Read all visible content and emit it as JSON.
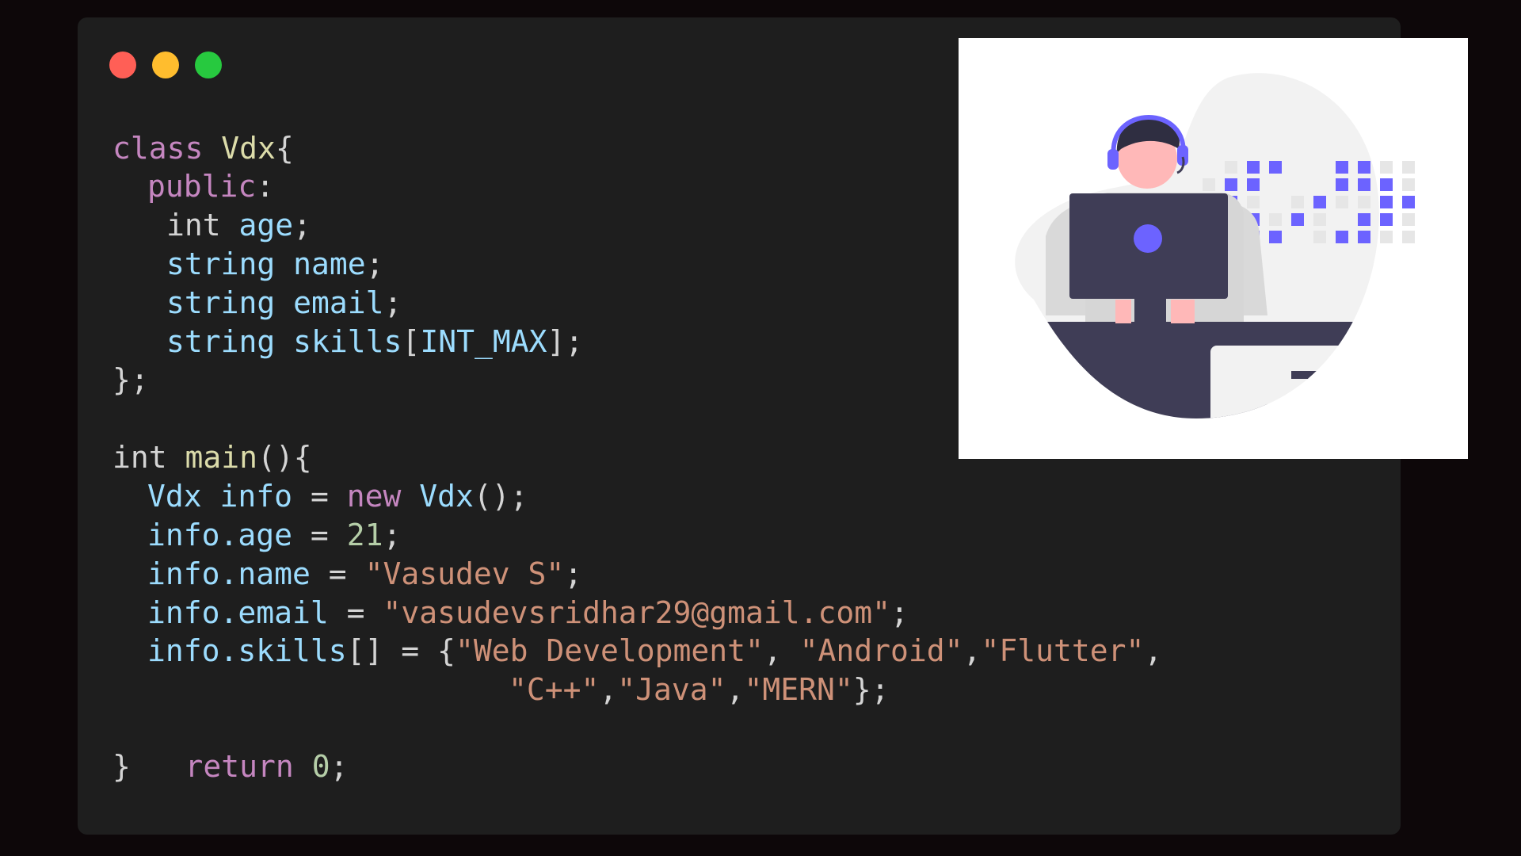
{
  "window": {
    "controls": [
      "close",
      "minimize",
      "maximize"
    ]
  },
  "code": {
    "l1": {
      "kw": "class",
      "cls": "Vdx",
      "rest": "{"
    },
    "l2": {
      "kw": "public",
      "rest": ":"
    },
    "l3": {
      "ty": "int",
      "var": "age",
      "rest": ";"
    },
    "l4": {
      "ty": "string",
      "var": "name",
      "rest": ";"
    },
    "l5": {
      "ty": "string",
      "var": "email",
      "rest": ";"
    },
    "l6": {
      "ty": "string",
      "var": "skills",
      "rest1": "[",
      "arr": "INT_MAX",
      "rest2": "];"
    },
    "l7": "};",
    "l8": {
      "ty": "int",
      "fn": "main",
      "rest": "(){"
    },
    "l9": {
      "cls": "Vdx",
      "var": "info",
      "op": "=",
      "kw": "new",
      "cls2": "Vdx",
      "rest": "();"
    },
    "l10": {
      "var": "info.age",
      "op": "=",
      "num": "21",
      "rest": ";"
    },
    "l11": {
      "var": "info.name",
      "op": "=",
      "str": "\"Vasudev S\"",
      "rest": ";"
    },
    "l12": {
      "var": "info.email",
      "op": "=",
      "str": "\"vasudevsridhar29@gmail.com\"",
      "rest": ";"
    },
    "l13": {
      "var": "info.skills",
      "rest1": "[] = {",
      "s1": "\"Web Development\"",
      "c1": ", ",
      "s2": "\"Android\"",
      "c2": ",",
      "s3": "\"Flutter\"",
      "c3": ","
    },
    "l14": {
      "s4": "\"C++\"",
      "c4": ",",
      "s5": "\"Java\"",
      "c5": ",",
      "s6": "\"MERN\"",
      "rest": "};"
    },
    "l15": {
      "brace": "}",
      "kw": "return",
      "num": "0",
      "rest": ";"
    }
  },
  "illustration": {
    "accent": "#6c63ff",
    "dark": "#3f3d56",
    "skin": "#ffb8b8",
    "hair": "#2f2e41",
    "light": "#f2f2f2"
  }
}
